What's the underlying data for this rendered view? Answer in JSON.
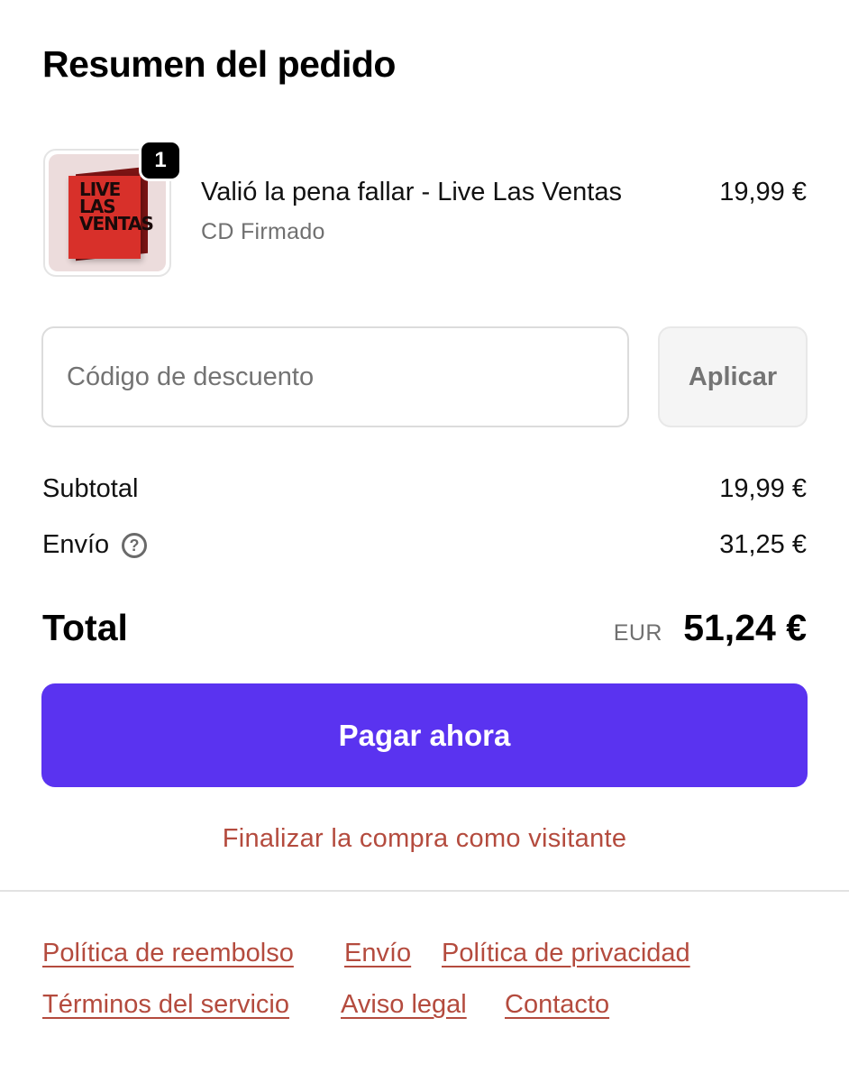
{
  "title": "Resumen del pedido",
  "item": {
    "quantity": "1",
    "name": "Valió la pena fallar - Live Las Ventas",
    "variant": "CD Firmado",
    "price": "19,99 €",
    "cover_text": [
      "LIVE",
      "LAS",
      "VENTAS"
    ]
  },
  "discount": {
    "placeholder": "Código de descuento",
    "value": "",
    "apply_label": "Aplicar"
  },
  "summary": {
    "subtotal_label": "Subtotal",
    "subtotal_value": "19,99 €",
    "shipping_label": "Envío",
    "shipping_value": "31,25 €",
    "total_label": "Total",
    "currency": "EUR",
    "total_value": "51,24 €"
  },
  "pay_label": "Pagar ahora",
  "guest_label": "Finalizar la compra como visitante",
  "footer": {
    "links": [
      "Política de reembolso",
      "Envío",
      "Política de privacidad",
      "Términos del servicio",
      "Aviso legal",
      "Contacto"
    ]
  },
  "colors": {
    "accent": "#5a33f0",
    "link": "#b44b3e"
  },
  "icons": {
    "help": "question-circle-icon"
  }
}
